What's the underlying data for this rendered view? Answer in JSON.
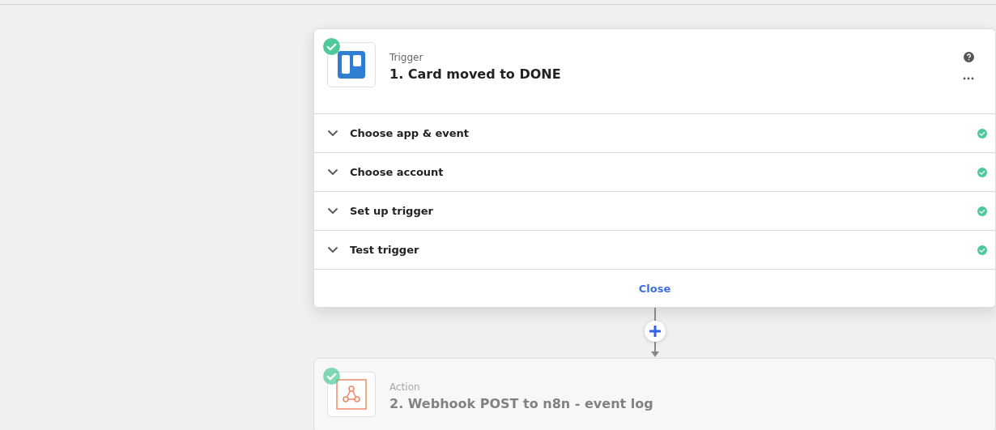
{
  "steps": [
    {
      "kind": "trigger",
      "done": true,
      "faded": false,
      "type_label": "Trigger",
      "title": "1. Card moved to DONE",
      "sections": [
        {
          "label": "Choose app & event",
          "done": true
        },
        {
          "label": "Choose account",
          "done": true
        },
        {
          "label": "Set up trigger",
          "done": true
        },
        {
          "label": "Test trigger",
          "done": true
        }
      ],
      "close_button": "Close"
    },
    {
      "kind": "webhook",
      "done": true,
      "faded": true,
      "type_label": "Action",
      "title": "2. Webhook POST to n8n - event log"
    }
  ]
}
